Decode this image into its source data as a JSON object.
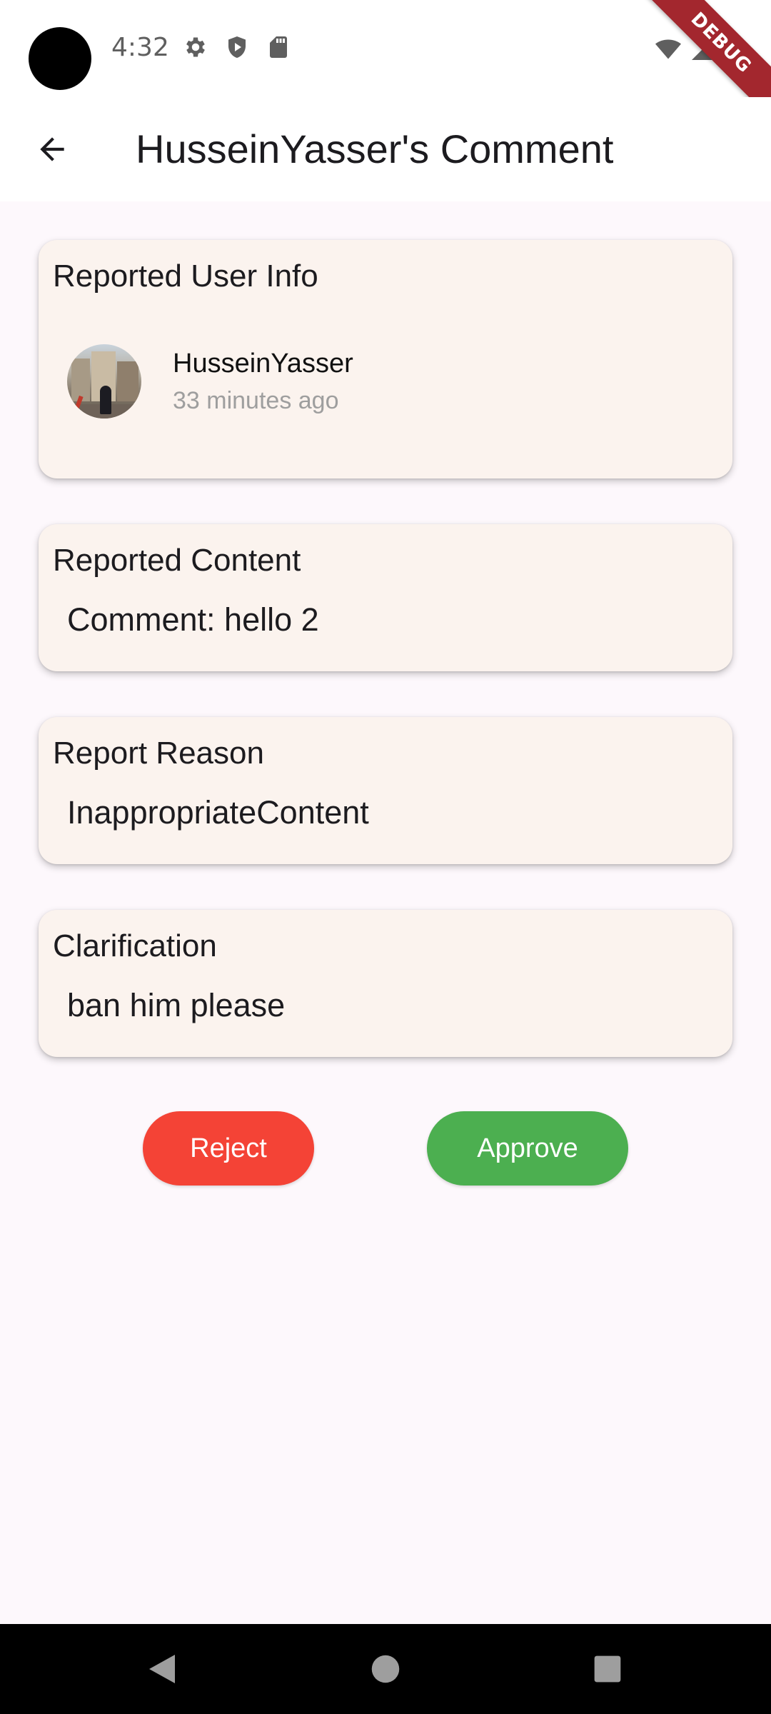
{
  "status_bar": {
    "time": "4:32",
    "left_icons": [
      "settings-icon",
      "shield-play-icon",
      "sd-card-icon"
    ],
    "right_icons": [
      "wifi-icon",
      "signal-icon",
      "battery-icon"
    ],
    "debug_banner": "DEBUG"
  },
  "app_bar": {
    "back_icon": "arrow-left-icon",
    "title": "HusseinYasser's Comment"
  },
  "reported_user": {
    "section_title": "Reported User Info",
    "username": "HusseinYasser",
    "time_ago": "33 minutes ago"
  },
  "reported_content": {
    "section_title": "Reported Content",
    "text": "Comment: hello 2"
  },
  "report_reason": {
    "section_title": "Report Reason",
    "text": "InappropriateContent"
  },
  "clarification": {
    "section_title": "Clarification",
    "text": "ban him please"
  },
  "actions": {
    "reject_label": "Reject",
    "approve_label": "Approve",
    "reject_color": "#f44336",
    "approve_color": "#4caf50"
  },
  "nav_bar": {
    "buttons": [
      "back-triangle-icon",
      "home-circle-icon",
      "recents-square-icon"
    ]
  }
}
